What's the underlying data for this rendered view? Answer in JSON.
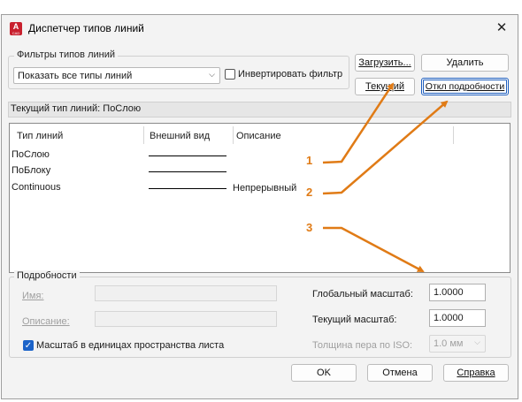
{
  "window": {
    "title": "Диспетчер типов линий",
    "close_glyph": "✕",
    "icon_letter": "A",
    "icon_sub": "CAD"
  },
  "filters": {
    "group_label": "Фильтры типов линий",
    "selected": "Показать все типы линий",
    "invert_label": "Инвертировать фильтр",
    "invert_checked": false
  },
  "buttons": {
    "load": "Загрузить...",
    "delete": "Удалить",
    "current": "Текущий",
    "hide_details": "Откл подробности",
    "ok": "OK",
    "cancel": "Отмена",
    "help": "Справка"
  },
  "current_linetype": "Текущий тип линий:  ПоСлою",
  "list": {
    "columns": [
      "Тип линий",
      "Внешний вид",
      "Описание"
    ],
    "rows": [
      {
        "name": "ПоСлою",
        "description": ""
      },
      {
        "name": "ПоБлоку",
        "description": ""
      },
      {
        "name": "Continuous",
        "description": "Непрерывный"
      }
    ]
  },
  "details": {
    "group_label": "Подробности",
    "name_label": "Имя:",
    "description_label": "Описание:",
    "paper_space_label": "Масштаб в единицах пространства листа",
    "paper_space_checked": true,
    "global_scale_label": "Глобальный масштаб:",
    "global_scale_value": "1.0000",
    "current_scale_label": "Текущий масштаб:",
    "current_scale_value": "1.0000",
    "pen_width_label": "Толщина пера по ISO:",
    "pen_width_value": "1.0 мм"
  },
  "callouts": [
    "1",
    "2",
    "3"
  ],
  "colors": {
    "accent": "#1b63c9",
    "callout": "#e07b16",
    "brand": "#c8202e"
  }
}
